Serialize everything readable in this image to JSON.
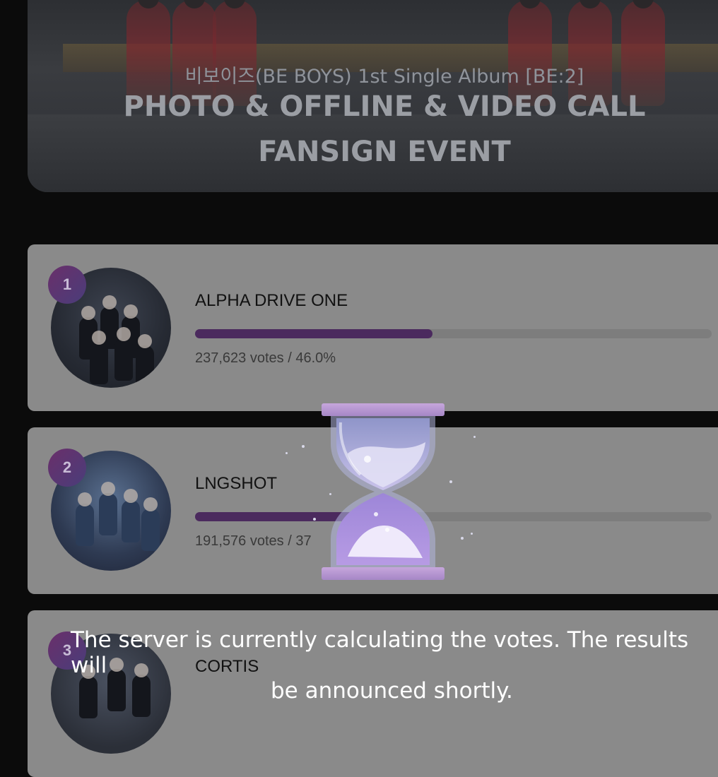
{
  "banner": {
    "subtitle": "비보이즈(BE BOYS) 1st Single Album [BE:2]",
    "title_line1": "PHOTO & OFFLINE & VIDEO CALL",
    "title_line2": "FANSIGN EVENT"
  },
  "ranking": [
    {
      "rank": "1",
      "name": "ALPHA DRIVE ONE",
      "votes_text": "237,623 votes / 46.0%",
      "share": 0.46
    },
    {
      "rank": "2",
      "name": "LNGSHOT",
      "votes_text": "191,576 votes / 37",
      "share": 0.37
    },
    {
      "rank": "3",
      "name": "CORTIS",
      "votes_text": "",
      "share": 0
    }
  ],
  "overlay": {
    "icon": "hourglass-icon",
    "message_line1": "The server is currently calculating the votes. The results will",
    "message_line2": "be announced shortly."
  },
  "colors": {
    "page_bg": "#0b0b0b",
    "card_bg": "#8a8a8a",
    "bar_fill": "#4b2a5e",
    "rank_badge": "#5a3570"
  }
}
